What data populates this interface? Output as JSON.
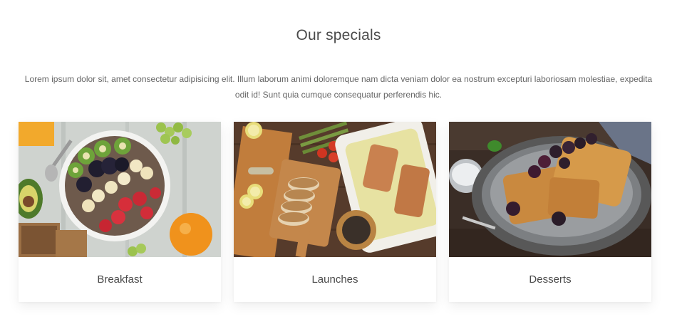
{
  "section": {
    "title": "Our specials",
    "description": "Lorem ipsum dolor sit, amet consectetur adipisicing elit. Illum laborum animi doloremque nam dicta veniam dolor ea nostrum excepturi laboriosam molestiae, expedita odit id! Sunt quia cumque consequatur perferendis hic."
  },
  "cards": [
    {
      "label": "Breakfast",
      "image": "breakfast-bowl-photo"
    },
    {
      "label": "Launches",
      "image": "salmon-and-bread-photo"
    },
    {
      "label": "Desserts",
      "image": "waffles-with-berries-photo"
    }
  ]
}
